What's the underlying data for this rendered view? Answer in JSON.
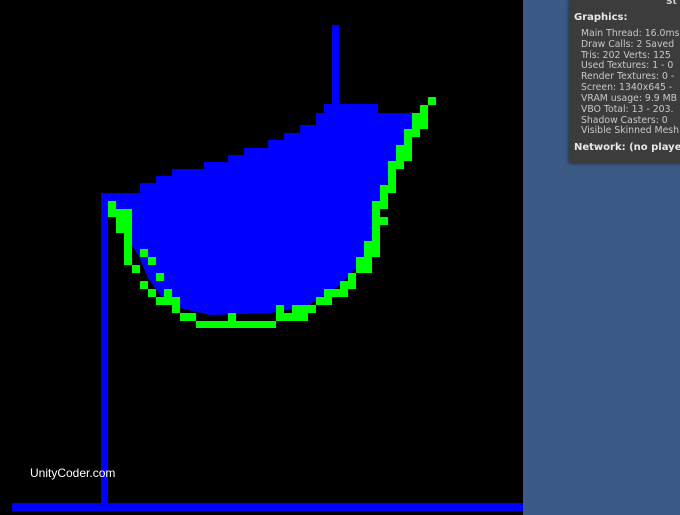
{
  "game_view": {
    "watermark": "UnityCoder.com",
    "colors": {
      "background": "#000000",
      "wall": "#0000ff",
      "water": "#0000ff",
      "outline": "#00ff00"
    }
  },
  "stats": {
    "title": "St",
    "graphics_heading": "Graphics:",
    "lines": [
      "Main Thread: 16.0ms",
      "Draw Calls: 2   Saved",
      "Tris: 202  Verts: 125",
      "Used Textures: 1 - 0",
      "Render Textures: 0 -",
      "Screen: 1340x645 -",
      "VRAM usage: 9.9 MB",
      "VBO Total: 13 - 203.",
      "Shadow Casters: 0",
      "Visible Skinned Mesh"
    ],
    "network": "Network: (no player"
  }
}
